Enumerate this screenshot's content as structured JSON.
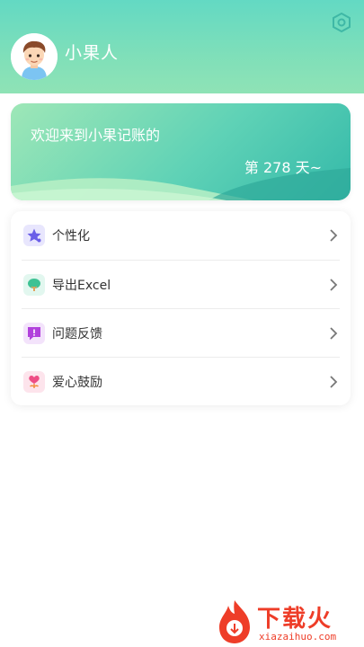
{
  "profile": {
    "username": "小果人"
  },
  "welcome": {
    "message": "欢迎来到小果记账的",
    "days": "第 278 天~"
  },
  "menu": {
    "items": [
      {
        "label": "个性化",
        "icon": "star-icon",
        "color": "#7b6ff0"
      },
      {
        "label": "导出Excel",
        "icon": "tree-icon",
        "color": "#4cc79b"
      },
      {
        "label": "问题反馈",
        "icon": "feedback-icon",
        "color": "#b54de0"
      },
      {
        "label": "爱心鼓励",
        "icon": "heart-flower-icon",
        "color": "#ef5d8c"
      }
    ]
  },
  "watermark": {
    "title": "下载火",
    "site": "xiazaihuo.com"
  },
  "colors": {
    "header": "#63d9c3",
    "card_start": "#9ee7b7",
    "card_end": "#34b9a9",
    "watermark": "#ee3d28"
  }
}
